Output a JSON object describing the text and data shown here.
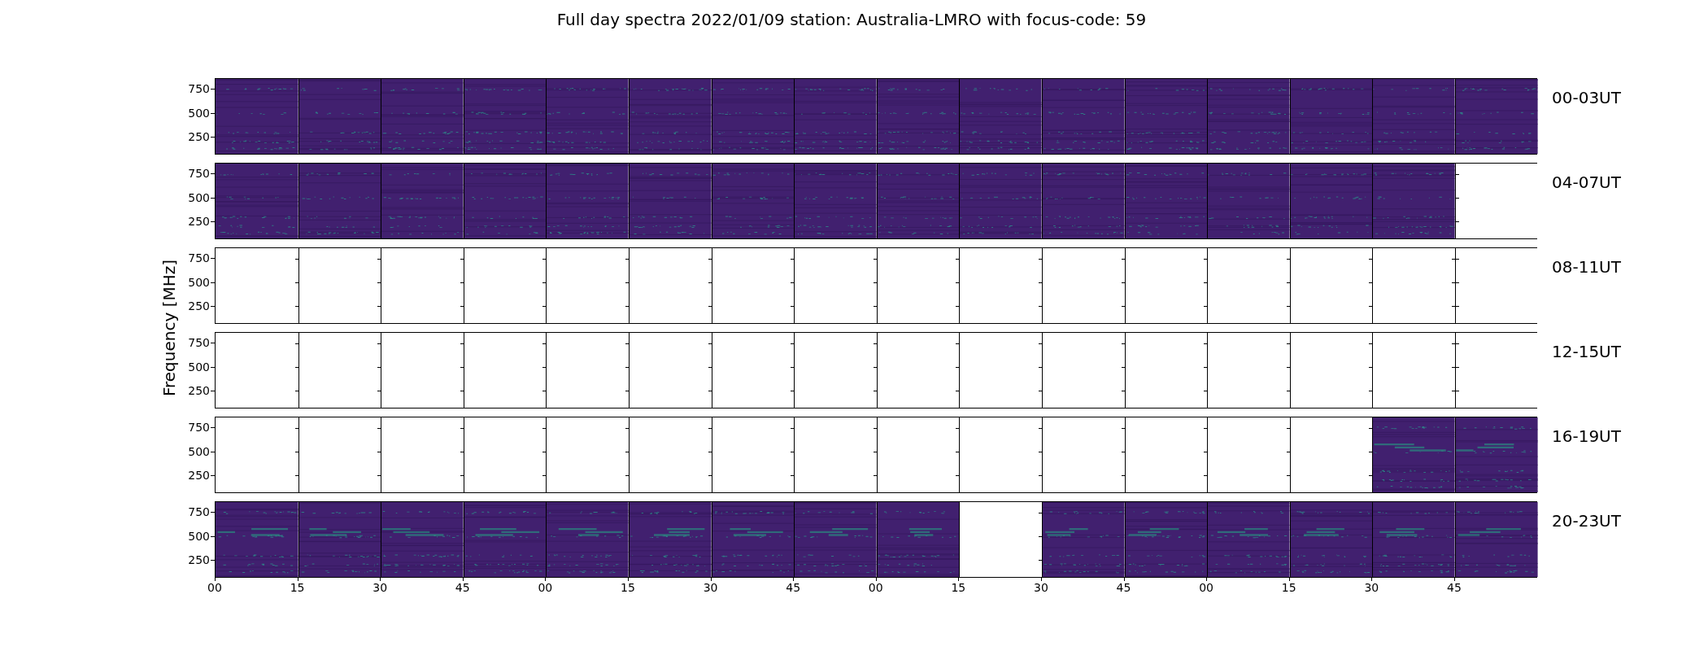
{
  "title": "Full day spectra 2022/01/09 station: Australia-LMRO with focus-code: 59",
  "ylabel": "Frequency [MHz]",
  "rows": [
    {
      "label": "00-03UT",
      "yticks": [
        "750",
        "500",
        "250"
      ],
      "panels": [
        {
          "kind": "spectrogram"
        },
        {
          "kind": "spectrogram"
        },
        {
          "kind": "spectrogram"
        },
        {
          "kind": "spectrogram"
        },
        {
          "kind": "spectrogram"
        },
        {
          "kind": "spectrogram"
        },
        {
          "kind": "spectrogram"
        },
        {
          "kind": "spectrogram"
        },
        {
          "kind": "spectrogram"
        },
        {
          "kind": "spectrogram"
        },
        {
          "kind": "spectrogram"
        },
        {
          "kind": "spectrogram"
        },
        {
          "kind": "spectrogram"
        },
        {
          "kind": "spectrogram"
        },
        {
          "kind": "spectrogram"
        },
        {
          "kind": "spectrogram"
        }
      ]
    },
    {
      "label": "04-07UT",
      "yticks": [
        "750",
        "500",
        "250"
      ],
      "panels": [
        {
          "kind": "spectrogram"
        },
        {
          "kind": "spectrogram"
        },
        {
          "kind": "spectrogram"
        },
        {
          "kind": "spectrogram"
        },
        {
          "kind": "spectrogram"
        },
        {
          "kind": "spectrogram"
        },
        {
          "kind": "spectrogram"
        },
        {
          "kind": "spectrogram"
        },
        {
          "kind": "spectrogram"
        },
        {
          "kind": "spectrogram"
        },
        {
          "kind": "spectrogram"
        },
        {
          "kind": "spectrogram"
        },
        {
          "kind": "spectrogram"
        },
        {
          "kind": "spectrogram"
        },
        {
          "kind": "spectrogram"
        },
        {
          "kind": "empty"
        }
      ]
    },
    {
      "label": "08-11UT",
      "yticks": [
        "750",
        "500",
        "250"
      ],
      "panels": [
        {
          "kind": "empty"
        },
        {
          "kind": "empty"
        },
        {
          "kind": "empty"
        },
        {
          "kind": "empty"
        },
        {
          "kind": "empty"
        },
        {
          "kind": "empty"
        },
        {
          "kind": "empty"
        },
        {
          "kind": "empty"
        },
        {
          "kind": "empty"
        },
        {
          "kind": "empty"
        },
        {
          "kind": "empty"
        },
        {
          "kind": "empty"
        },
        {
          "kind": "empty"
        },
        {
          "kind": "empty"
        },
        {
          "kind": "empty"
        },
        {
          "kind": "empty"
        }
      ]
    },
    {
      "label": "12-15UT",
      "yticks": [
        "750",
        "500",
        "250"
      ],
      "panels": [
        {
          "kind": "empty"
        },
        {
          "kind": "empty"
        },
        {
          "kind": "empty"
        },
        {
          "kind": "empty"
        },
        {
          "kind": "empty"
        },
        {
          "kind": "empty"
        },
        {
          "kind": "empty"
        },
        {
          "kind": "empty"
        },
        {
          "kind": "empty"
        },
        {
          "kind": "empty"
        },
        {
          "kind": "empty"
        },
        {
          "kind": "empty"
        },
        {
          "kind": "empty"
        },
        {
          "kind": "empty"
        },
        {
          "kind": "empty"
        },
        {
          "kind": "empty"
        }
      ]
    },
    {
      "label": "16-19UT",
      "yticks": [
        "750",
        "500",
        "250"
      ],
      "panels": [
        {
          "kind": "empty"
        },
        {
          "kind": "empty"
        },
        {
          "kind": "empty"
        },
        {
          "kind": "empty"
        },
        {
          "kind": "empty"
        },
        {
          "kind": "empty"
        },
        {
          "kind": "empty"
        },
        {
          "kind": "empty"
        },
        {
          "kind": "empty"
        },
        {
          "kind": "empty"
        },
        {
          "kind": "empty"
        },
        {
          "kind": "empty"
        },
        {
          "kind": "empty"
        },
        {
          "kind": "empty"
        },
        {
          "kind": "spectrogram"
        },
        {
          "kind": "spectrogram"
        }
      ]
    },
    {
      "label": "20-23UT",
      "yticks": [
        "750",
        "500",
        "250"
      ],
      "panels": [
        {
          "kind": "spectrogram"
        },
        {
          "kind": "spectrogram"
        },
        {
          "kind": "spectrogram"
        },
        {
          "kind": "spectrogram"
        },
        {
          "kind": "spectrogram"
        },
        {
          "kind": "spectrogram"
        },
        {
          "kind": "spectrogram"
        },
        {
          "kind": "spectrogram"
        },
        {
          "kind": "spectrogram"
        },
        {
          "kind": "empty"
        },
        {
          "kind": "spectrogram"
        },
        {
          "kind": "spectrogram"
        },
        {
          "kind": "spectrogram"
        },
        {
          "kind": "spectrogram"
        },
        {
          "kind": "spectrogram"
        },
        {
          "kind": "spectrogram"
        }
      ]
    }
  ],
  "xticks": [
    "00",
    "15",
    "30",
    "45",
    "00",
    "15",
    "30",
    "45",
    "00",
    "15",
    "30",
    "45",
    "00",
    "15",
    "30",
    "45"
  ]
}
